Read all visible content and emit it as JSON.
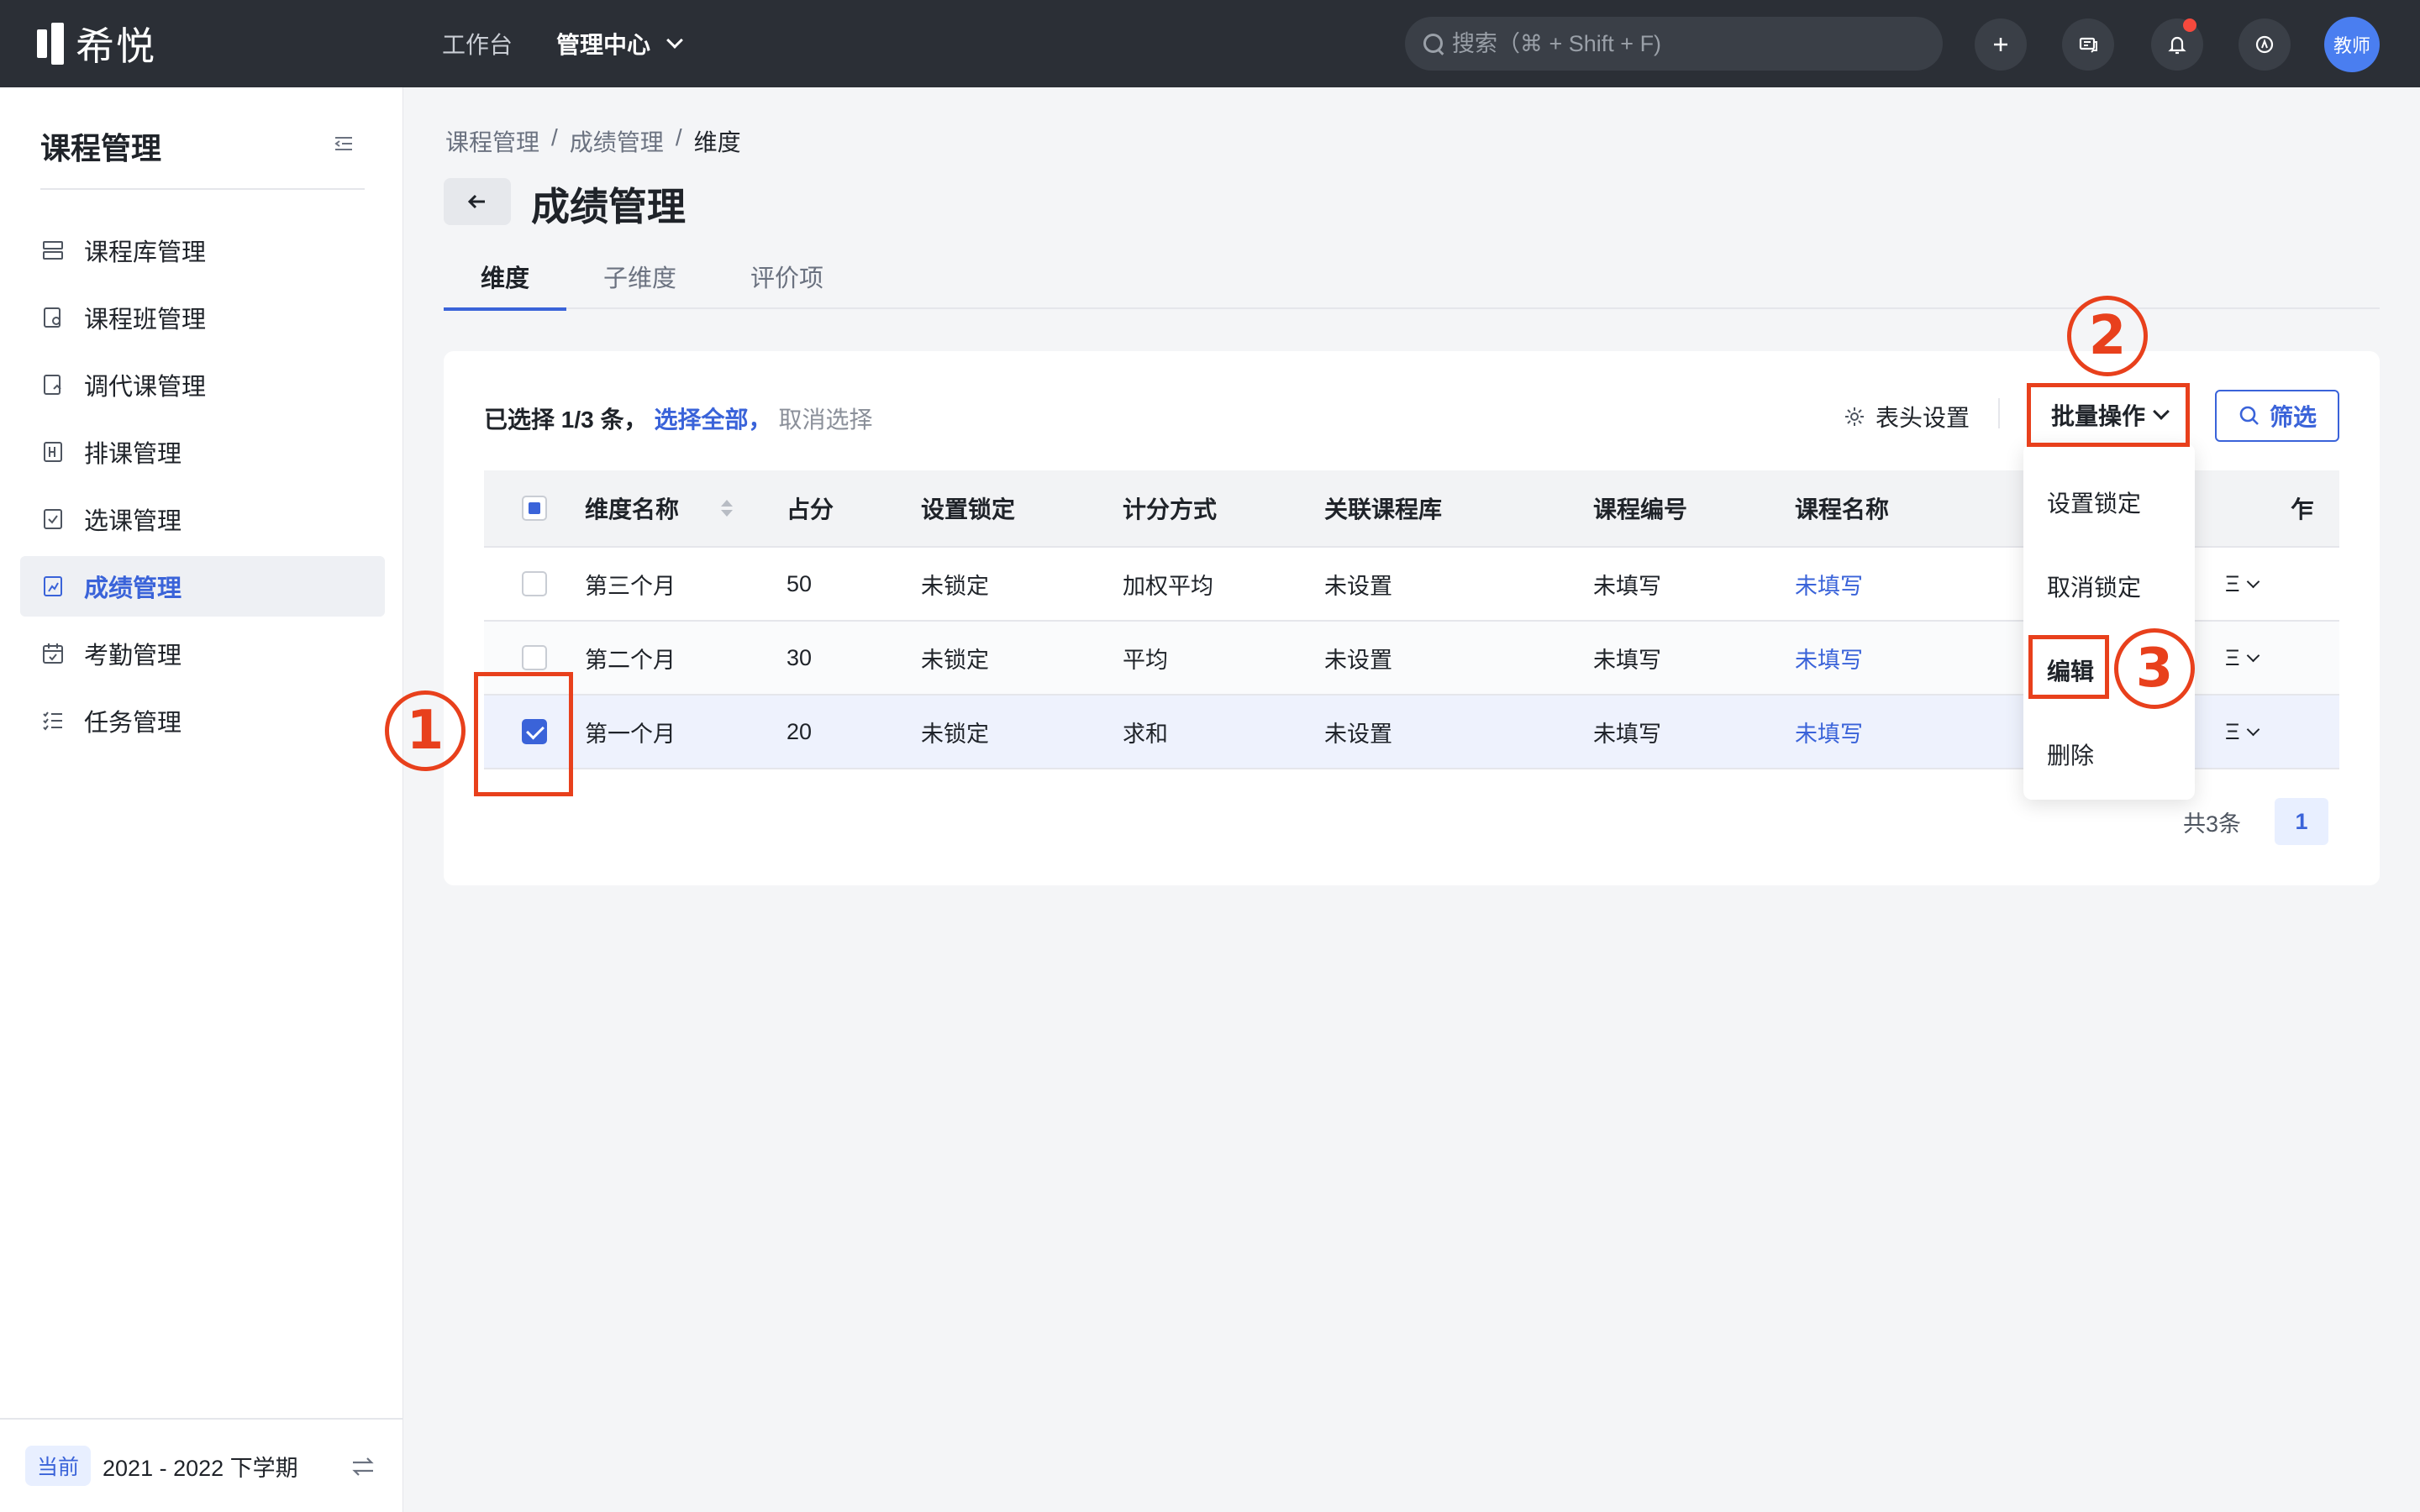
{
  "topbar": {
    "logo_text": "希悦",
    "nav": [
      "工作台",
      "管理中心"
    ],
    "search_placeholder": "搜索（⌘ + Shift + F)",
    "avatar_label": "教师"
  },
  "sidebar": {
    "title": "课程管理",
    "items": [
      {
        "label": "课程库管理",
        "icon": "library-icon"
      },
      {
        "label": "课程班管理",
        "icon": "class-icon"
      },
      {
        "label": "调代课管理",
        "icon": "substitute-icon"
      },
      {
        "label": "排课管理",
        "icon": "schedule-icon"
      },
      {
        "label": "选课管理",
        "icon": "selection-icon"
      },
      {
        "label": "成绩管理",
        "icon": "grade-icon"
      },
      {
        "label": "考勤管理",
        "icon": "attendance-icon"
      },
      {
        "label": "任务管理",
        "icon": "task-icon"
      }
    ],
    "active_index": 5,
    "footer": {
      "badge": "当前",
      "term": "2021 - 2022 下学期"
    }
  },
  "breadcrumb": {
    "items": [
      "课程管理",
      "成绩管理",
      "维度"
    ],
    "sep": "/"
  },
  "page": {
    "title": "成绩管理"
  },
  "tabs": [
    "维度",
    "子维度",
    "评价项"
  ],
  "toolbar": {
    "selected_count": "已选择 1/3 条，",
    "select_all": "选择全部，",
    "cancel_select": "取消选择",
    "header_settings": "表头设置",
    "batch": "批量操作",
    "filter": "筛选"
  },
  "table": {
    "columns": [
      "维度名称",
      "占分",
      "设置锁定",
      "计分方式",
      "关联课程库",
      "课程编号",
      "课程名称"
    ],
    "rows": [
      {
        "name": "第三个月",
        "score": "50",
        "lock": "未锁定",
        "method": "加权平均",
        "library": "未设置",
        "code": "未填写",
        "course": "未填写",
        "checked": false
      },
      {
        "name": "第二个月",
        "score": "30",
        "lock": "未锁定",
        "method": "平均",
        "library": "未设置",
        "code": "未填写",
        "course": "未填写",
        "checked": false
      },
      {
        "name": "第一个月",
        "score": "20",
        "lock": "未锁定",
        "method": "求和",
        "library": "未设置",
        "code": "未填写",
        "course": "未填写",
        "checked": true
      }
    ]
  },
  "pagination": {
    "total": "共3条",
    "page": "1"
  },
  "dropdown": {
    "items": [
      "设置锁定",
      "取消锁定",
      "编辑",
      "删除"
    ]
  },
  "annotations": {
    "n1": "1",
    "n2": "2",
    "n3": "3",
    "color": "#e8401c"
  },
  "colors": {
    "accent": "#3a63d9",
    "topbar": "#2b2f36"
  }
}
